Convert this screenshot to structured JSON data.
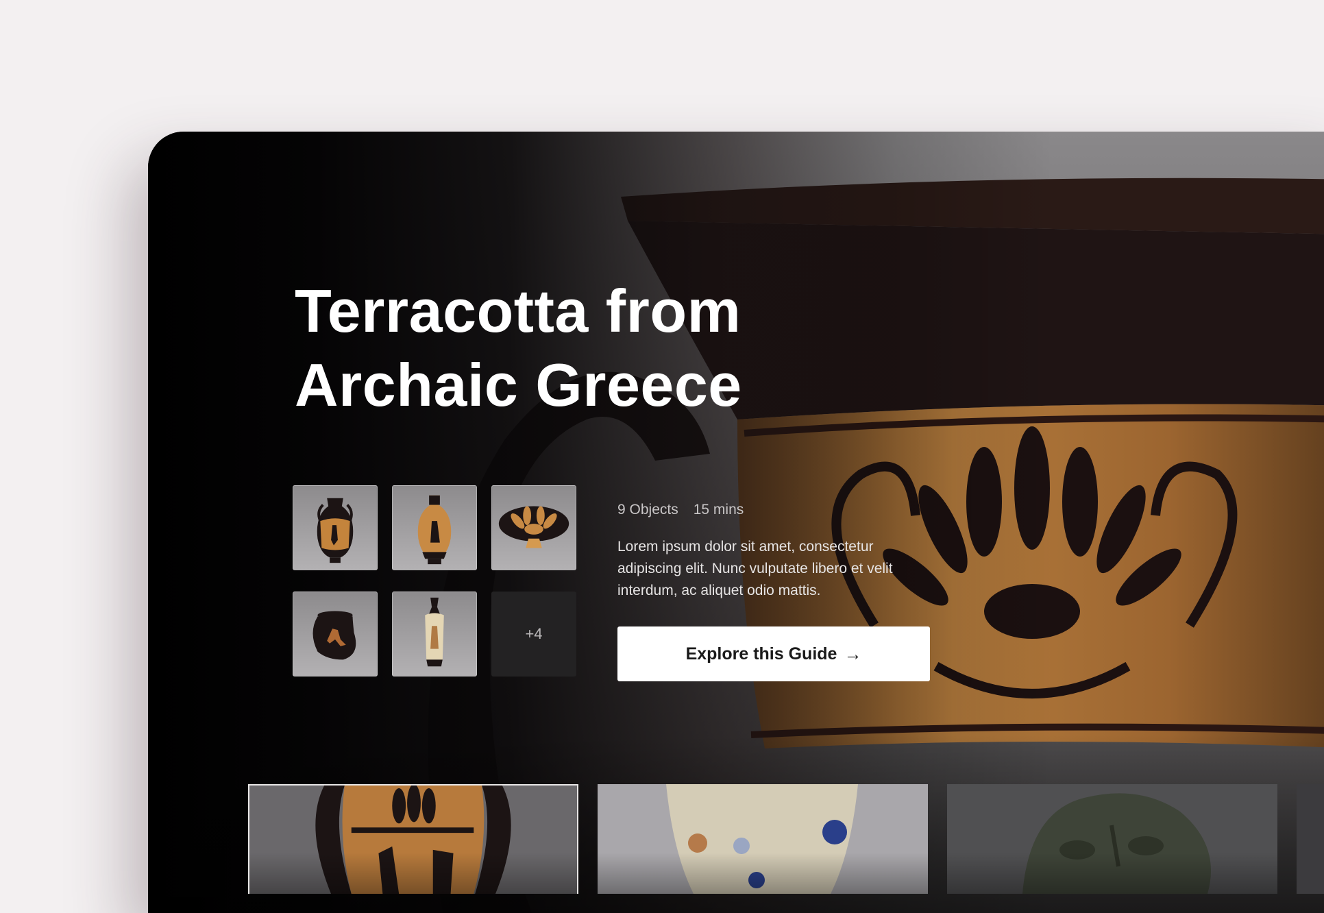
{
  "guide": {
    "title_line_1": "Terracotta from",
    "title_line_2": "Archaic Greece",
    "objects_label": "9 Objects",
    "duration_label": "15 mins",
    "description": "Lorem ipsum dolor sit amet, consectetur adipiscing elit. Nunc vulputate libero et velit interdum, ac aliquet odio mattis.",
    "cta_label": "Explore this Guide",
    "cta_icon": "arrow-right-icon",
    "more_count_label": "+4"
  },
  "thumbnails": [
    {
      "name": "black-figure-amphora"
    },
    {
      "name": "panathenaic-amphora"
    },
    {
      "name": "kylix-cup"
    },
    {
      "name": "red-figure-pot"
    },
    {
      "name": "white-ground-lekythos"
    }
  ],
  "carousel": [
    {
      "name": "amphora-card",
      "active": true
    },
    {
      "name": "glass-vessel-card",
      "active": false
    },
    {
      "name": "stone-head-card",
      "active": false
    },
    {
      "name": "partial-card",
      "active": false
    }
  ],
  "colors": {
    "background": "#f3f0f1",
    "hero": "#000000",
    "terracotta": "#b77a3c",
    "black_glaze": "#1c1212",
    "cta_bg": "#ffffff",
    "cta_text": "#1a1a1a"
  }
}
